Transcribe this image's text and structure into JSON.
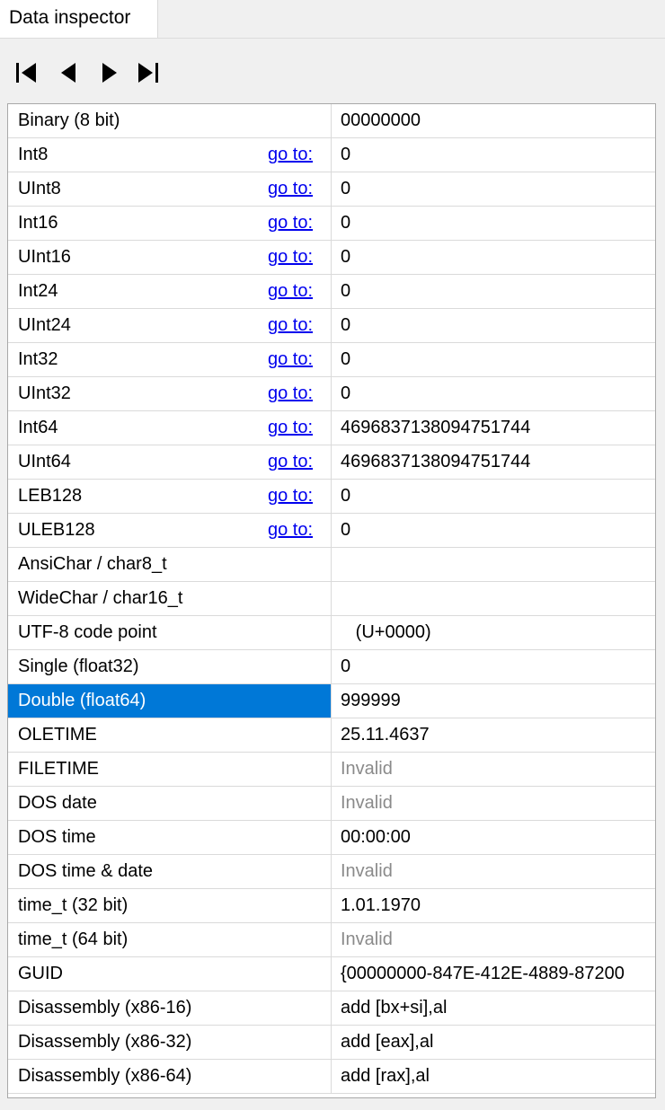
{
  "panel": {
    "tab_label": "Data inspector"
  },
  "toolbar": {
    "buttons": [
      {
        "icon": "first-icon",
        "label": "First"
      },
      {
        "icon": "previous-icon",
        "label": "Previous"
      },
      {
        "icon": "next-icon",
        "label": "Next"
      },
      {
        "icon": "last-icon",
        "label": "Last"
      }
    ]
  },
  "colors": {
    "selection": "#0078d7",
    "link": "#0000ee",
    "invalid_text": "#8a8a8a"
  },
  "rows": [
    {
      "name": "Binary (8 bit)",
      "goto": "",
      "value": "00000000",
      "invalid": false,
      "selected": false
    },
    {
      "name": "Int8",
      "goto": "go to:",
      "value": "0",
      "invalid": false,
      "selected": false
    },
    {
      "name": "UInt8",
      "goto": "go to:",
      "value": "0",
      "invalid": false,
      "selected": false
    },
    {
      "name": "Int16",
      "goto": "go to:",
      "value": "0",
      "invalid": false,
      "selected": false
    },
    {
      "name": "UInt16",
      "goto": "go to:",
      "value": "0",
      "invalid": false,
      "selected": false
    },
    {
      "name": "Int24",
      "goto": "go to:",
      "value": "0",
      "invalid": false,
      "selected": false
    },
    {
      "name": "UInt24",
      "goto": "go to:",
      "value": "0",
      "invalid": false,
      "selected": false
    },
    {
      "name": "Int32",
      "goto": "go to:",
      "value": "0",
      "invalid": false,
      "selected": false
    },
    {
      "name": "UInt32",
      "goto": "go to:",
      "value": "0",
      "invalid": false,
      "selected": false
    },
    {
      "name": "Int64",
      "goto": "go to:",
      "value": "4696837138094751744",
      "invalid": false,
      "selected": false
    },
    {
      "name": "UInt64",
      "goto": "go to:",
      "value": "4696837138094751744",
      "invalid": false,
      "selected": false
    },
    {
      "name": "LEB128",
      "goto": "go to:",
      "value": "0",
      "invalid": false,
      "selected": false
    },
    {
      "name": "ULEB128",
      "goto": "go to:",
      "value": "0",
      "invalid": false,
      "selected": false
    },
    {
      "name": "AnsiChar / char8_t",
      "goto": "",
      "value": "",
      "invalid": false,
      "selected": false
    },
    {
      "name": "WideChar / char16_t",
      "goto": "",
      "value": "",
      "invalid": false,
      "selected": false
    },
    {
      "name": "UTF-8 code point",
      "goto": "",
      "value": "   (U+0000)",
      "invalid": false,
      "selected": false
    },
    {
      "name": "Single (float32)",
      "goto": "",
      "value": "0",
      "invalid": false,
      "selected": false
    },
    {
      "name": "Double (float64)",
      "goto": "",
      "value": "999999",
      "invalid": false,
      "selected": true
    },
    {
      "name": "OLETIME",
      "goto": "",
      "value": "25.11.4637",
      "invalid": false,
      "selected": false
    },
    {
      "name": "FILETIME",
      "goto": "",
      "value": "Invalid",
      "invalid": true,
      "selected": false
    },
    {
      "name": "DOS date",
      "goto": "",
      "value": "Invalid",
      "invalid": true,
      "selected": false
    },
    {
      "name": "DOS time",
      "goto": "",
      "value": "00:00:00",
      "invalid": false,
      "selected": false
    },
    {
      "name": "DOS time & date",
      "goto": "",
      "value": "Invalid",
      "invalid": true,
      "selected": false
    },
    {
      "name": "time_t (32 bit)",
      "goto": "",
      "value": "1.01.1970",
      "invalid": false,
      "selected": false
    },
    {
      "name": "time_t (64 bit)",
      "goto": "",
      "value": "Invalid",
      "invalid": true,
      "selected": false
    },
    {
      "name": "GUID",
      "goto": "",
      "value": "{00000000-847E-412E-4889-87200",
      "invalid": false,
      "selected": false
    },
    {
      "name": "Disassembly (x86-16)",
      "goto": "",
      "value": "add [bx+si],al",
      "invalid": false,
      "selected": false
    },
    {
      "name": "Disassembly (x86-32)",
      "goto": "",
      "value": "add [eax],al",
      "invalid": false,
      "selected": false
    },
    {
      "name": "Disassembly (x86-64)",
      "goto": "",
      "value": "add [rax],al",
      "invalid": false,
      "selected": false
    }
  ]
}
